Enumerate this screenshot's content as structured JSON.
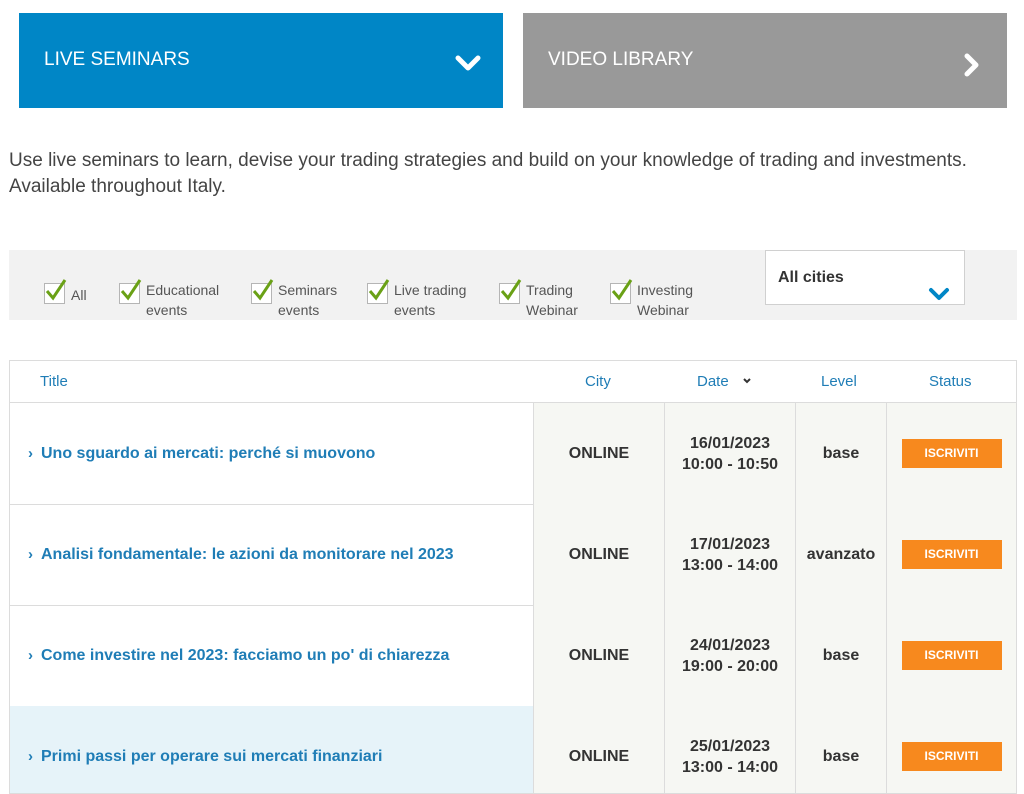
{
  "tabs": {
    "live": {
      "label": "LIVE SEMINARS",
      "icon": "chevron-down-icon",
      "color": "#0086c6"
    },
    "video": {
      "label": "VIDEO LIBRARY",
      "icon": "chevron-right-icon",
      "color": "#999999"
    }
  },
  "intro": "Use live seminars to learn, devise your trading strategies and build on your knowledge of trading and investments. Available throughout Italy.",
  "filters": [
    {
      "label": "All",
      "checked": true
    },
    {
      "label": "Educational events",
      "checked": true
    },
    {
      "label": "Seminars events",
      "checked": true
    },
    {
      "label": "Live trading events",
      "checked": true
    },
    {
      "label": "Trading Webinar",
      "checked": true
    },
    {
      "label": "Investing Webinar",
      "checked": true
    }
  ],
  "city_select": {
    "value": "All cities",
    "icon": "chevron-down-icon"
  },
  "table": {
    "headers": {
      "title": "Title",
      "city": "City",
      "date": "Date",
      "level": "Level",
      "status": "Status"
    },
    "rows": [
      {
        "title": "Uno sguardo ai mercati: perché si muovono",
        "city": "ONLINE",
        "date": "16/01/2023",
        "time": "10:00 - 10:50",
        "level": "base",
        "status": "ISCRIVITI"
      },
      {
        "title": "Analisi fondamentale: le azioni da monitorare nel 2023",
        "city": "ONLINE",
        "date": "17/01/2023",
        "time": "13:00 - 14:00",
        "level": "avanzato",
        "status": "ISCRIVITI"
      },
      {
        "title": "Come investire nel 2023: facciamo un po' di chiarezza",
        "city": "ONLINE",
        "date": "24/01/2023",
        "time": "19:00 - 20:00",
        "level": "base",
        "status": "ISCRIVITI"
      },
      {
        "title": "Primi passi per operare sui mercati finanziari",
        "city": "ONLINE",
        "date": "25/01/2023",
        "time": "13:00 - 14:00",
        "level": "base",
        "status": "ISCRIVITI"
      }
    ]
  },
  "colors": {
    "accent": "#0086c6",
    "link": "#1f7db6",
    "button": "#f7891e",
    "check": "#6aa116"
  }
}
